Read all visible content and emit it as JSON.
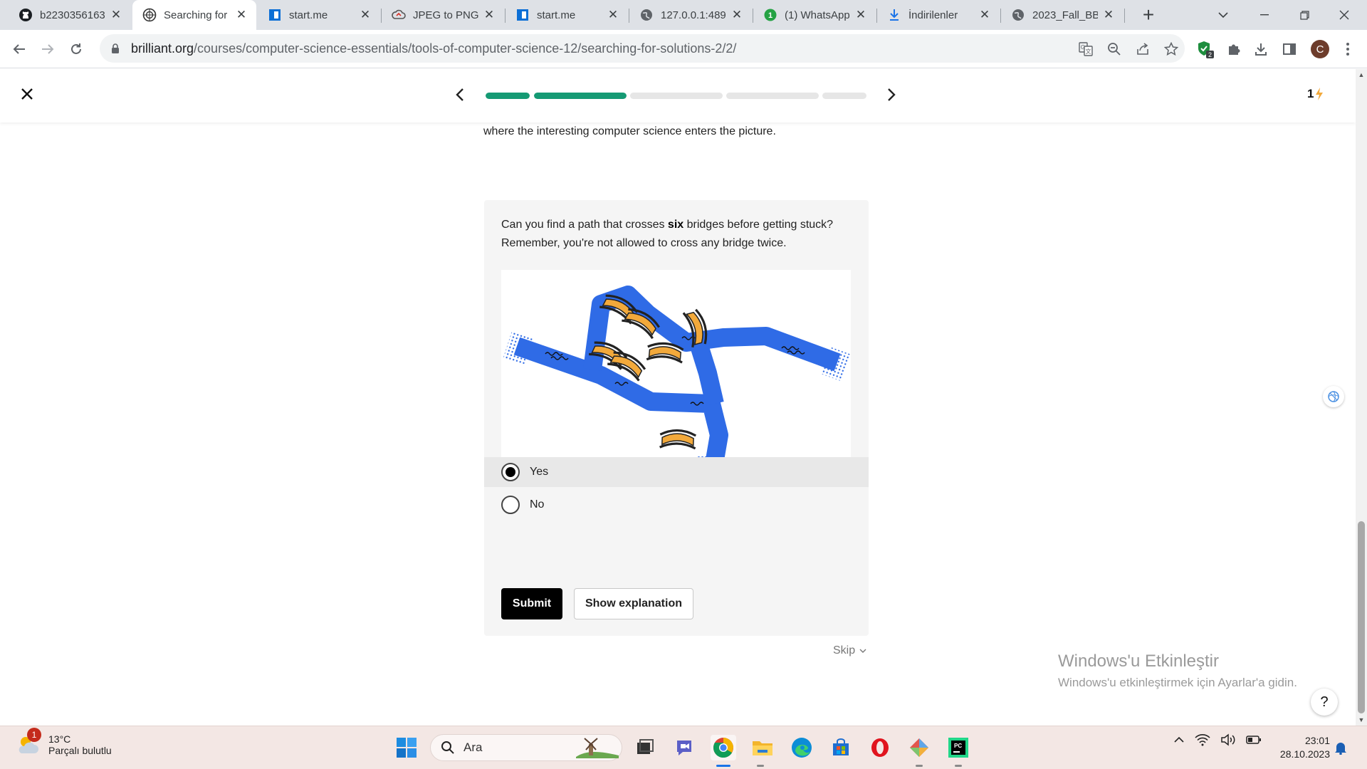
{
  "browser": {
    "tabs": [
      {
        "title": "b2230356163",
        "icon": "github-icon"
      },
      {
        "title": "Searching for",
        "icon": "brilliant-icon",
        "active": true
      },
      {
        "title": "start.me",
        "icon": "startme-icon"
      },
      {
        "title": "JPEG to PNG",
        "icon": "cloud-icon"
      },
      {
        "title": "start.me",
        "icon": "startme-icon"
      },
      {
        "title": "127.0.0.1:489",
        "icon": "globe-icon"
      },
      {
        "title": "(1) WhatsApp",
        "icon": "whatsapp-icon"
      },
      {
        "title": "İndirilenler",
        "icon": "download-icon"
      },
      {
        "title": "2023_Fall_BB",
        "icon": "globe-icon"
      }
    ],
    "new_tab_label": "+",
    "address": {
      "host": "brilliant.org",
      "path": "/courses/computer-science-essentials/tools-of-computer-science-12/searching-for-solutions-2/2/"
    },
    "profile_initial": "C",
    "extension_badge": "2"
  },
  "lesson": {
    "progress_segments": [
      1.0,
      1.0,
      0.0,
      0.0,
      0.0
    ],
    "streak_count": "1",
    "intro_tail": "where the interesting computer science enters the picture.",
    "prompt_line1_pre": "Can you find a path that crosses ",
    "prompt_bold": "six",
    "prompt_line1_post": " bridges before getting stuck?",
    "prompt_line2": "Remember, you're not allowed to cross any bridge twice.",
    "options": [
      {
        "label": "Yes",
        "selected": true
      },
      {
        "label": "No",
        "selected": false
      }
    ],
    "submit_label": "Submit",
    "explain_label": "Show explanation",
    "skip_label": "Skip",
    "help_label": "?"
  },
  "figure": {
    "river_color": "#2f6be6",
    "bridge_color": "#f2a93b",
    "bridge_count": 7
  },
  "watermark": {
    "title": "Windows'u Etkinleştir",
    "subtitle": "Windows'u etkinleştirmek için Ayarlar'a gidin."
  },
  "taskbar": {
    "weather_badge": "1",
    "temperature": "13°C",
    "condition": "Parçalı bulutlu",
    "search_placeholder": "Ara",
    "time": "23:01",
    "date": "28.10.2023"
  }
}
